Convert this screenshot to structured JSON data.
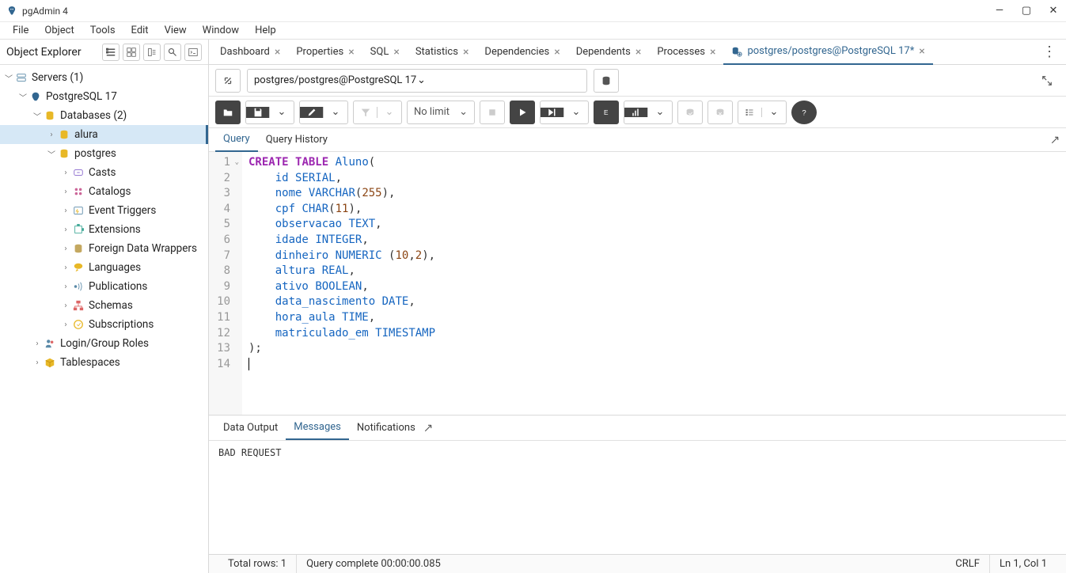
{
  "titlebar": {
    "title": "pgAdmin 4"
  },
  "menu": {
    "file": "File",
    "object": "Object",
    "tools": "Tools",
    "edit": "Edit",
    "view": "View",
    "window": "Window",
    "help": "Help"
  },
  "sidebar": {
    "title": "Object Explorer",
    "nodes": {
      "servers": "Servers (1)",
      "pg17": "PostgreSQL 17",
      "databases": "Databases (2)",
      "alura": "alura",
      "postgres": "postgres",
      "casts": "Casts",
      "catalogs": "Catalogs",
      "event_triggers": "Event Triggers",
      "extensions": "Extensions",
      "fdw": "Foreign Data Wrappers",
      "languages": "Languages",
      "publications": "Publications",
      "schemas": "Schemas",
      "subscriptions": "Subscriptions",
      "login_roles": "Login/Group Roles",
      "tablespaces": "Tablespaces"
    }
  },
  "tabs": {
    "dashboard": "Dashboard",
    "properties": "Properties",
    "sql": "SQL",
    "statistics": "Statistics",
    "dependencies": "Dependencies",
    "dependents": "Dependents",
    "processes": "Processes",
    "query": "postgres/postgres@PostgreSQL 17*"
  },
  "connbar": {
    "conn": "postgres/postgres@PostgreSQL 17"
  },
  "toolbar": {
    "limit": "No limit"
  },
  "subtabs": {
    "query": "Query",
    "history": "Query History"
  },
  "editor": {
    "lines": [
      {
        "n": 1,
        "fold": true,
        "tokens": [
          [
            "kw",
            "CREATE"
          ],
          [
            "pn",
            " "
          ],
          [
            "kw",
            "TABLE"
          ],
          [
            "pn",
            " "
          ],
          [
            "id2",
            "Aluno"
          ],
          [
            "pn",
            "("
          ]
        ]
      },
      {
        "n": 2,
        "tokens": [
          [
            "pn",
            "    "
          ],
          [
            "id2",
            "id"
          ],
          [
            "pn",
            " "
          ],
          [
            "ty",
            "SERIAL"
          ],
          [
            "pn",
            ","
          ]
        ]
      },
      {
        "n": 3,
        "tokens": [
          [
            "pn",
            "    "
          ],
          [
            "id2",
            "nome"
          ],
          [
            "pn",
            " "
          ],
          [
            "ty",
            "VARCHAR"
          ],
          [
            "pn",
            "("
          ],
          [
            "num",
            "255"
          ],
          [
            "pn",
            "),"
          ]
        ]
      },
      {
        "n": 4,
        "tokens": [
          [
            "pn",
            "    "
          ],
          [
            "id2",
            "cpf"
          ],
          [
            "pn",
            " "
          ],
          [
            "ty",
            "CHAR"
          ],
          [
            "pn",
            "("
          ],
          [
            "num",
            "11"
          ],
          [
            "pn",
            "),"
          ]
        ]
      },
      {
        "n": 5,
        "tokens": [
          [
            "pn",
            "    "
          ],
          [
            "id2",
            "observacao"
          ],
          [
            "pn",
            " "
          ],
          [
            "ty",
            "TEXT"
          ],
          [
            "pn",
            ","
          ]
        ]
      },
      {
        "n": 6,
        "tokens": [
          [
            "pn",
            "    "
          ],
          [
            "id2",
            "idade"
          ],
          [
            "pn",
            " "
          ],
          [
            "ty",
            "INTEGER"
          ],
          [
            "pn",
            ","
          ]
        ]
      },
      {
        "n": 7,
        "tokens": [
          [
            "pn",
            "    "
          ],
          [
            "id2",
            "dinheiro"
          ],
          [
            "pn",
            " "
          ],
          [
            "ty",
            "NUMERIC"
          ],
          [
            "pn",
            " ("
          ],
          [
            "num",
            "10"
          ],
          [
            "pn",
            ","
          ],
          [
            "num",
            "2"
          ],
          [
            "pn",
            "),"
          ]
        ]
      },
      {
        "n": 8,
        "tokens": [
          [
            "pn",
            "    "
          ],
          [
            "id2",
            "altura"
          ],
          [
            "pn",
            " "
          ],
          [
            "ty",
            "REAL"
          ],
          [
            "pn",
            ","
          ]
        ]
      },
      {
        "n": 9,
        "tokens": [
          [
            "pn",
            "    "
          ],
          [
            "id2",
            "ativo"
          ],
          [
            "pn",
            " "
          ],
          [
            "ty",
            "BOOLEAN"
          ],
          [
            "pn",
            ","
          ]
        ]
      },
      {
        "n": 10,
        "tokens": [
          [
            "pn",
            "    "
          ],
          [
            "id2",
            "data_nascimento"
          ],
          [
            "pn",
            " "
          ],
          [
            "ty",
            "DATE"
          ],
          [
            "pn",
            ","
          ]
        ]
      },
      {
        "n": 11,
        "tokens": [
          [
            "pn",
            "    "
          ],
          [
            "id2",
            "hora_aula"
          ],
          [
            "pn",
            " "
          ],
          [
            "ty",
            "TIME"
          ],
          [
            "pn",
            ","
          ]
        ]
      },
      {
        "n": 12,
        "tokens": [
          [
            "pn",
            "    "
          ],
          [
            "id2",
            "matriculado_em"
          ],
          [
            "pn",
            " "
          ],
          [
            "ty",
            "TIMESTAMP"
          ]
        ]
      },
      {
        "n": 13,
        "tokens": [
          [
            "pn",
            ");"
          ]
        ]
      },
      {
        "n": 14,
        "tokens": [],
        "cursor": true
      }
    ]
  },
  "output": {
    "tabs": {
      "data": "Data Output",
      "messages": "Messages",
      "notifications": "Notifications"
    },
    "message": "BAD REQUEST"
  },
  "status": {
    "rows": "Total rows: 1",
    "query": "Query complete 00:00:00.085",
    "crlf": "CRLF",
    "pos": "Ln 1, Col 1"
  }
}
